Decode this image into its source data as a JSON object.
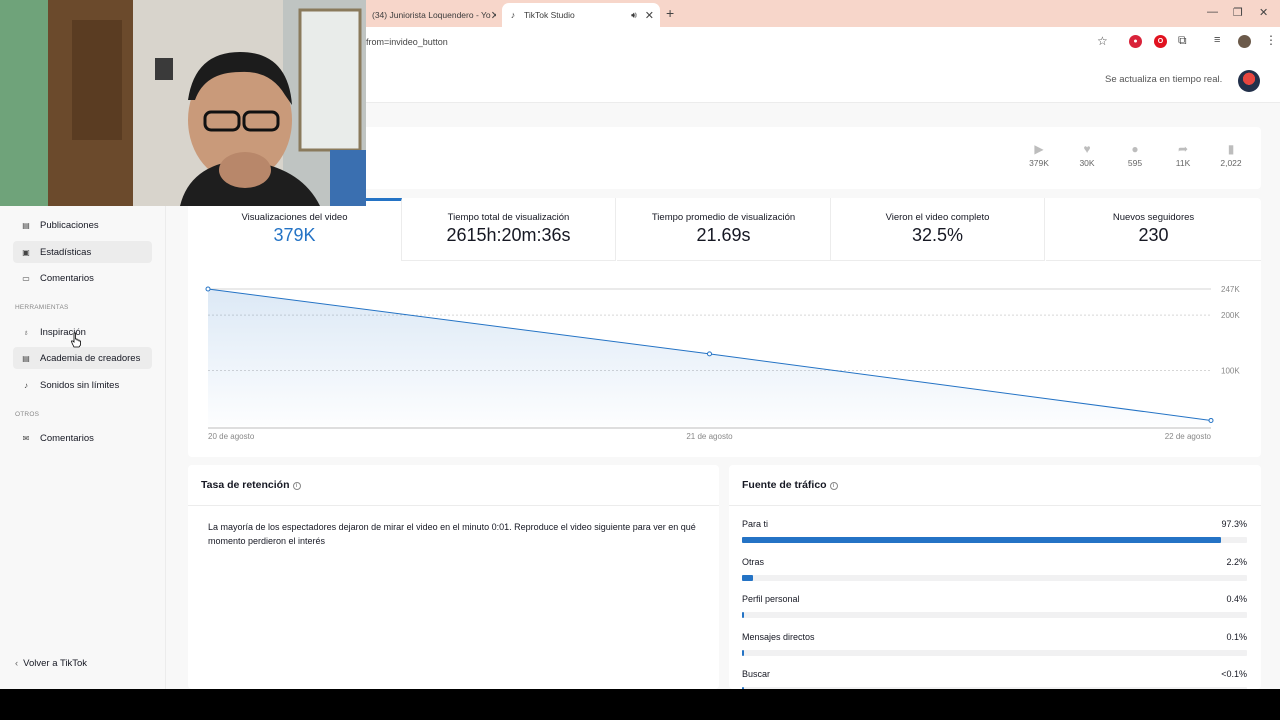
{
  "browser": {
    "tabs": [
      {
        "label": "(34) Juniorista Loquendero - Yo",
        "active": false
      },
      {
        "label": "TikTok Studio",
        "active": true
      }
    ],
    "url": "from=invideo_button"
  },
  "header": {
    "realtime_text": "Se actualiza en tiempo real."
  },
  "sidebar": {
    "items": [
      {
        "label": "Publicaciones",
        "icon": "document-icon",
        "active": false
      },
      {
        "label": "Estadísticas",
        "icon": "stats-icon",
        "active": true
      },
      {
        "label": "Comentarios",
        "icon": "comment-icon",
        "active": false
      }
    ],
    "tools_label": "HERRAMIENTAS",
    "tools": [
      {
        "label": "Inspiración",
        "icon": "lightbulb-icon"
      },
      {
        "label": "Academia de creadores",
        "icon": "academy-icon"
      },
      {
        "label": "Sonidos sin límites",
        "icon": "music-icon"
      }
    ],
    "others_label": "OTROS",
    "others": [
      {
        "label": "Comentarios",
        "icon": "mail-icon"
      }
    ],
    "back_label": "Volver a TikTok"
  },
  "video_stats": [
    {
      "icon": "play-icon",
      "value": "379K"
    },
    {
      "icon": "heart-icon",
      "value": "30K"
    },
    {
      "icon": "comment-icon",
      "value": "595"
    },
    {
      "icon": "share-icon",
      "value": "11K"
    },
    {
      "icon": "bookmark-icon",
      "value": "2,022"
    }
  ],
  "metrics": [
    {
      "label": "Visualizaciones del video",
      "value": "379K",
      "active": true
    },
    {
      "label": "Tiempo total de visualización",
      "value": "2615h:20m:36s",
      "active": false
    },
    {
      "label": "Tiempo promedio de visualización",
      "value": "21.69s",
      "active": false
    },
    {
      "label": "Vieron el video completo",
      "value": "32.5%",
      "active": false
    },
    {
      "label": "Nuevos seguidores",
      "value": "230",
      "active": false
    }
  ],
  "chart_data": {
    "type": "area",
    "x": [
      "20 de agosto",
      "21 de agosto",
      "22 de agosto"
    ],
    "y": [
      247000,
      130000,
      10000
    ],
    "yticks": [
      {
        "value": 247000,
        "label": "247K"
      },
      {
        "value": 200000,
        "label": "200K"
      },
      {
        "value": 100000,
        "label": "100K"
      }
    ],
    "ylim": [
      0,
      247000
    ],
    "color": "#2473c5",
    "grid": true
  },
  "retention": {
    "title": "Tasa de retención",
    "text": "La mayoría de los espectadores dejaron de mirar el video en el minuto 0:01. Reproduce el video siguiente para ver en qué momento perdieron el interés"
  },
  "traffic": {
    "title": "Fuente de tráfico",
    "sources": [
      {
        "label": "Para ti",
        "value": "97.3%",
        "fraction": 0.973
      },
      {
        "label": "Otras",
        "value": "2.2%",
        "fraction": 0.022
      },
      {
        "label": "Perfil personal",
        "value": "0.4%",
        "fraction": 0.004
      },
      {
        "label": "Mensajes directos",
        "value": "0.1%",
        "fraction": 0.001
      },
      {
        "label": "Buscar",
        "value": "<0.1%",
        "fraction": 0.0005
      }
    ]
  }
}
